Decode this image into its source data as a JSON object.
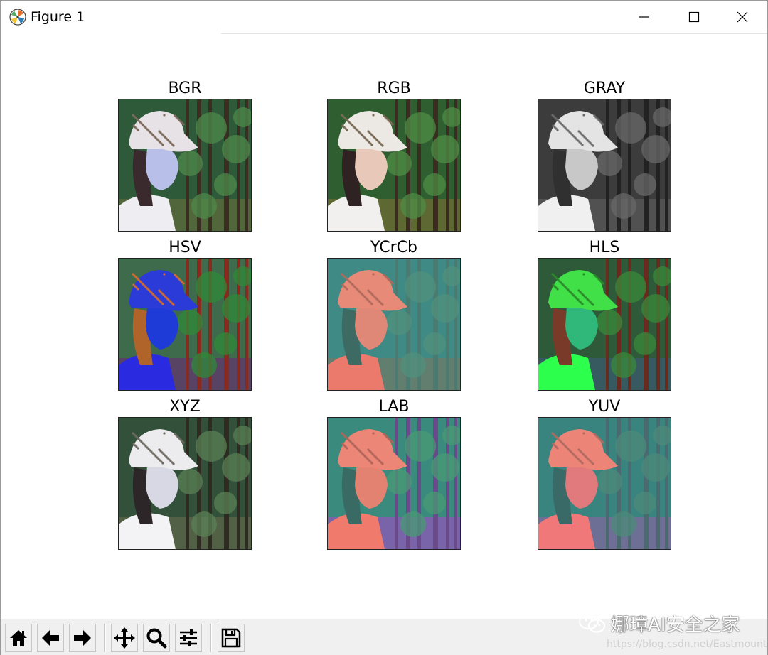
{
  "window": {
    "title": "Figure 1",
    "icon": "matplotlib-logo-icon",
    "controls": [
      "minimize-icon",
      "maximize-icon",
      "close-icon"
    ]
  },
  "figure": {
    "subplots": [
      {
        "title": "BGR",
        "palette": "bgr"
      },
      {
        "title": "RGB",
        "palette": "rgb"
      },
      {
        "title": "GRAY",
        "palette": "gray"
      },
      {
        "title": "HSV",
        "palette": "hsv"
      },
      {
        "title": "YCrCb",
        "palette": "ycrcb"
      },
      {
        "title": "HLS",
        "palette": "hls"
      },
      {
        "title": "XYZ",
        "palette": "xyz"
      },
      {
        "title": "LAB",
        "palette": "lab"
      },
      {
        "title": "YUV",
        "palette": "yuv"
      }
    ]
  },
  "toolbar": {
    "buttons": [
      {
        "name": "home-button",
        "icon": "home-icon"
      },
      {
        "name": "back-button",
        "icon": "arrow-left-icon"
      },
      {
        "name": "forward-button",
        "icon": "arrow-right-icon"
      },
      {
        "name": "pan-button",
        "icon": "move-arrows-icon"
      },
      {
        "name": "zoom-button",
        "icon": "magnifier-icon"
      },
      {
        "name": "configure-button",
        "icon": "sliders-icon"
      },
      {
        "name": "save-button",
        "icon": "floppy-disk-icon"
      }
    ]
  },
  "watermark": {
    "text": "娜璋AI安全之家",
    "url": "https://blog.csdn.net/Eastmount",
    "icon": "wechat-icon"
  }
}
